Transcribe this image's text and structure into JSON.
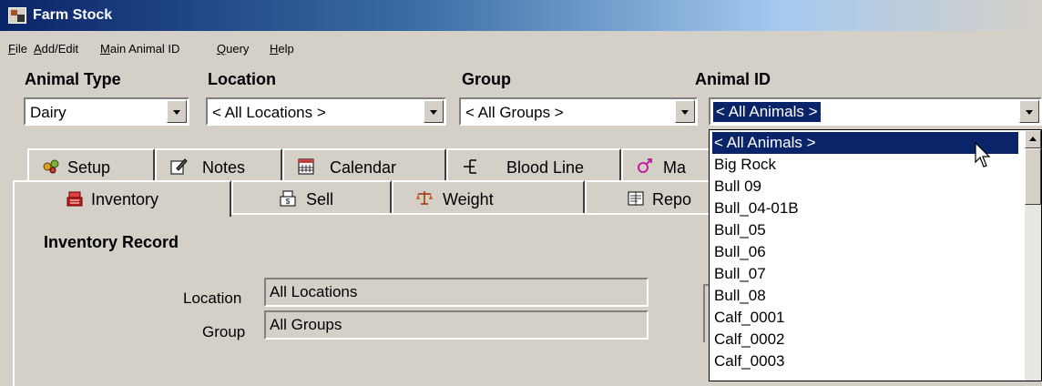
{
  "window": {
    "title": "Farm Stock"
  },
  "menu": [
    "File",
    "Add/Edit",
    "Main Animal ID",
    "Query",
    "Help"
  ],
  "filters": {
    "animal_type": {
      "label": "Animal Type",
      "value": "Dairy"
    },
    "location": {
      "label": "Location",
      "value": "< All Locations >"
    },
    "group": {
      "label": "Group",
      "value": "< All Groups >"
    },
    "animal_id": {
      "label": "Animal ID",
      "value": "< All Animals >"
    }
  },
  "tabs_top": [
    "Setup",
    "Notes",
    "Calendar",
    "Blood Line",
    "Ma"
  ],
  "tabs_bottom": [
    "Inventory",
    "Sell",
    "Weight",
    "Repo"
  ],
  "panel": {
    "title": "Inventory Record",
    "location_label": "Location",
    "location_value": "All Locations",
    "group_label": "Group",
    "group_value": "All Groups"
  },
  "animal_list": [
    "< All Animals >",
    "Big Rock",
    "Bull 09",
    "Bull_04-01B",
    "Bull_05",
    "Bull_06",
    "Bull_07",
    "Bull_08",
    "Calf_0001",
    "Calf_0002",
    "Calf_0003"
  ],
  "colors": {
    "selection": "#0a246a",
    "face": "#d4d0c8"
  }
}
